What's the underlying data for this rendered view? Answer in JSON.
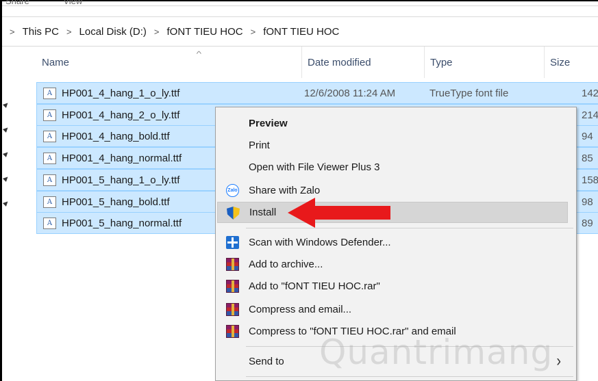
{
  "ribbon": {
    "items": [
      "Share",
      "View"
    ]
  },
  "breadcrumb": [
    "This PC",
    "Local Disk (D:)",
    "fONT TIEU HOC",
    "fONT TIEU HOC"
  ],
  "columns": {
    "name": "Name",
    "date": "Date modified",
    "type": "Type",
    "size": "Size"
  },
  "files": [
    {
      "name": "HP001_4_hang_1_o_ly.ttf",
      "date": "12/6/2008 11:24 AM",
      "type": "TrueType font file",
      "size": "142"
    },
    {
      "name": "HP001_4_hang_2_o_ly.ttf",
      "date": "",
      "type": "",
      "size": "214"
    },
    {
      "name": "HP001_4_hang_bold.ttf",
      "date": "",
      "type": "",
      "size": "94"
    },
    {
      "name": "HP001_4_hang_normal.ttf",
      "date": "",
      "type": "",
      "size": "85"
    },
    {
      "name": "HP001_5_hang_1_o_ly.ttf",
      "date": "",
      "type": "",
      "size": "158"
    },
    {
      "name": "HP001_5_hang_bold.ttf",
      "date": "",
      "type": "",
      "size": "98"
    },
    {
      "name": "HP001_5_hang_normal.ttf",
      "date": "",
      "type": "",
      "size": "89"
    }
  ],
  "file_icon_glyph": "A",
  "context_menu": {
    "preview": "Preview",
    "print": "Print",
    "open_with": "Open with File Viewer Plus 3",
    "share_zalo": "Share with Zalo",
    "zalo_icon_text": "Zalo",
    "install": "Install",
    "scan": "Scan with Windows Defender...",
    "add_archive": "Add to archive...",
    "add_to_rar": "Add to \"fONT TIEU HOC.rar\"",
    "compress_email": "Compress and email...",
    "compress_rar_email": "Compress to \"fONT TIEU HOC.rar\" and email",
    "send_to": "Send to",
    "chevron": "›"
  },
  "annotation": {
    "arrow_color": "#e8191b"
  },
  "watermark": "Quantrimang",
  "colors": {
    "selection": "#cce8ff",
    "selection_border": "#99d1ff",
    "menu_bg": "#f2f2f2",
    "menu_hover": "#d6d6d6"
  }
}
